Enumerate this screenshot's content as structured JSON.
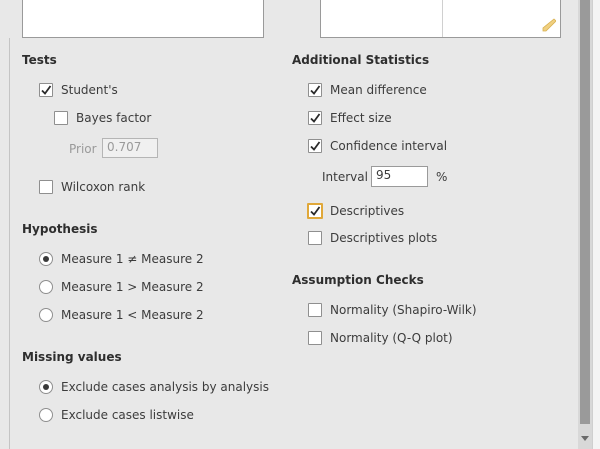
{
  "tests": {
    "title": "Tests",
    "students": "Student's",
    "bayes_factor": "Bayes factor",
    "prior_label": "Prior",
    "prior_value": "0.707",
    "wilcoxon": "Wilcoxon rank"
  },
  "hypothesis": {
    "title": "Hypothesis",
    "options": [
      "Measure 1 ≠ Measure 2",
      "Measure 1 > Measure 2",
      "Measure 1 < Measure 2"
    ],
    "selected": 0
  },
  "missing_values": {
    "title": "Missing values",
    "options": [
      "Exclude cases analysis by analysis",
      "Exclude cases listwise"
    ],
    "selected": 0
  },
  "additional_statistics": {
    "title": "Additional Statistics",
    "mean_difference": "Mean difference",
    "effect_size": "Effect size",
    "confidence_interval": "Confidence interval",
    "interval_label": "Interval",
    "interval_value": "95",
    "interval_unit": "%",
    "descriptives": "Descriptives",
    "descriptives_plots": "Descriptives plots"
  },
  "assumption_checks": {
    "title": "Assumption Checks",
    "normality_shapiro": "Normality (Shapiro-Wilk)",
    "normality_qq": "Normality (Q-Q plot)"
  },
  "colors": {
    "focus_ring": "#e0a83a",
    "resize_grip": "#f0d080"
  }
}
